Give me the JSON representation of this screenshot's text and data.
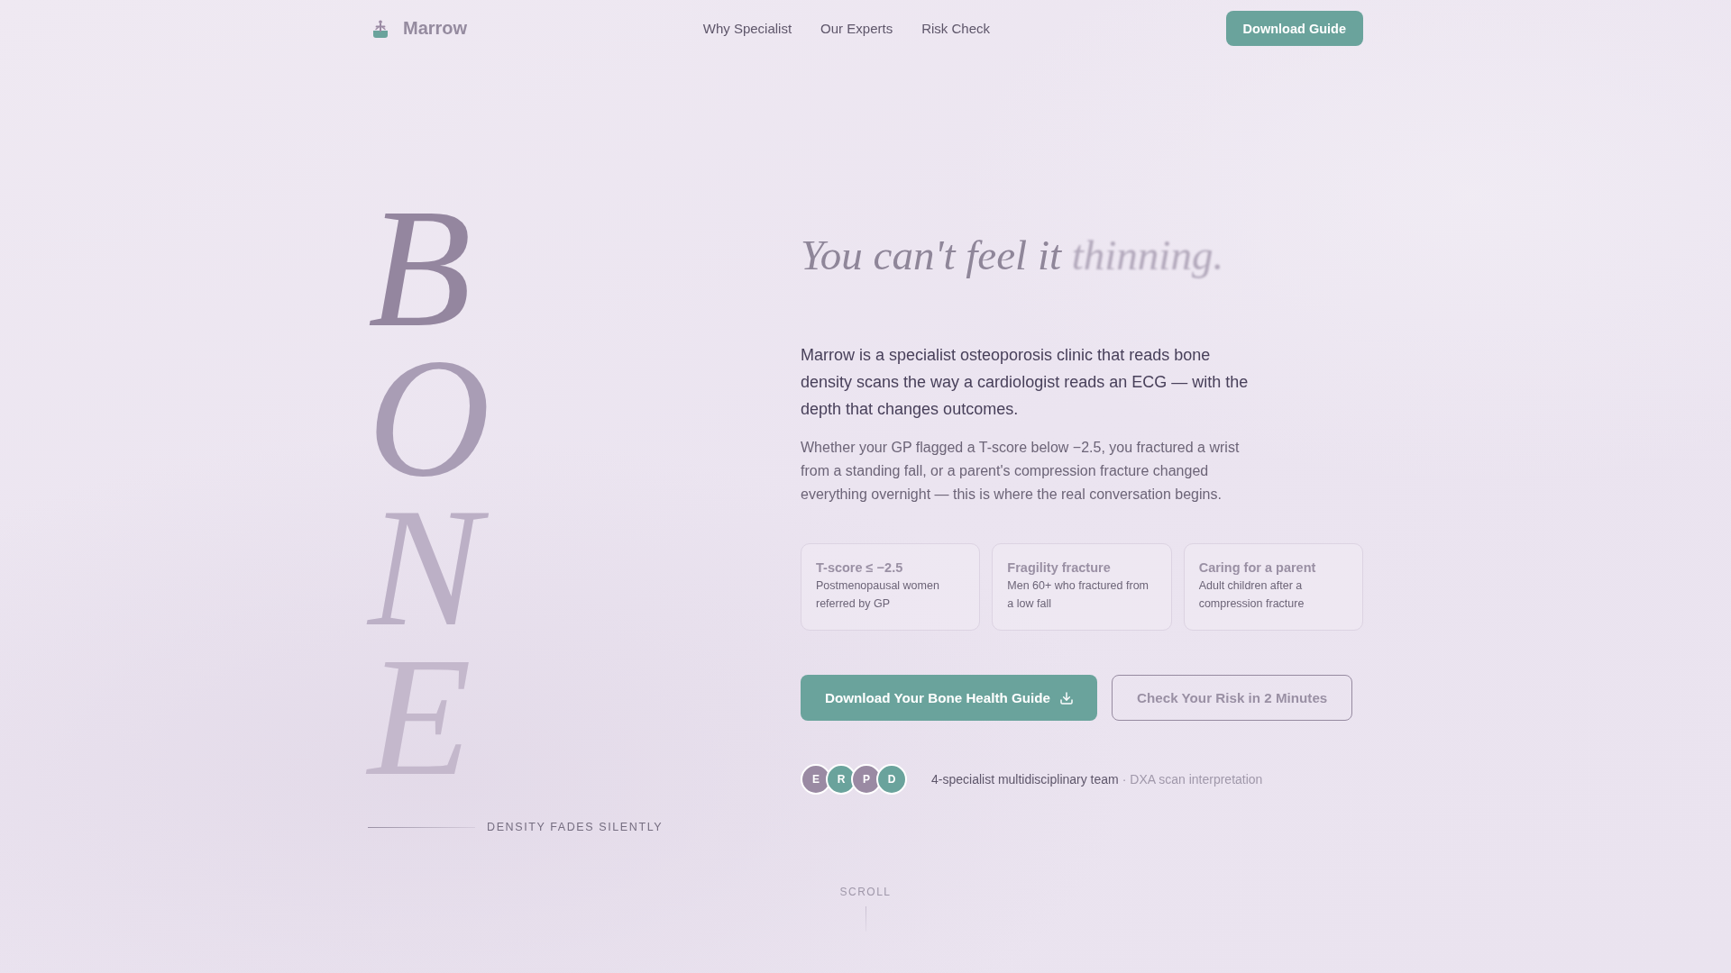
{
  "nav": {
    "brand": "Marrow",
    "links": [
      "Why Specialist",
      "Our Experts",
      "Risk Check"
    ],
    "cta": "Download Guide"
  },
  "wordmark": {
    "letters": [
      "B",
      "O",
      "N",
      "E"
    ],
    "caption": "DENSITY FADES SILENTLY"
  },
  "hero": {
    "headline": "You can't feel it",
    "headline_emphasis": "thinning.",
    "lead": "Marrow is a specialist osteoporosis clinic that reads bone density scans the way a cardiologist reads an ECG — with the depth that changes outcomes.",
    "body": "Whether your GP flagged a T-score below −2.5, you fractured a wrist from a standing fall, or a parent's compression fracture changed everything overnight — this is where the real conversation begins.",
    "audiences": [
      {
        "title": "T-score ≤ −2.5",
        "description": "Postmenopausal women referred by GP"
      },
      {
        "title": "Fragility fracture",
        "description": "Men 60+ who fractured from a low fall"
      },
      {
        "title": "Caring for a parent",
        "description": "Adult children after a compression fracture"
      }
    ],
    "primary_button": "Download Your Bone Health Guide",
    "secondary_button": "Check Your Risk in 2 Minutes",
    "team": {
      "avatars": [
        {
          "initial": "E",
          "color": "#9a8aa3"
        },
        {
          "initial": "R",
          "color": "#6aa39c"
        },
        {
          "initial": "P",
          "color": "#9a8aa3"
        },
        {
          "initial": "D",
          "color": "#6aa39c"
        }
      ],
      "label": "4-specialist multidisciplinary team",
      "detail": "· DXA scan interpretation"
    }
  },
  "scroll_hint": "SCROLL"
}
